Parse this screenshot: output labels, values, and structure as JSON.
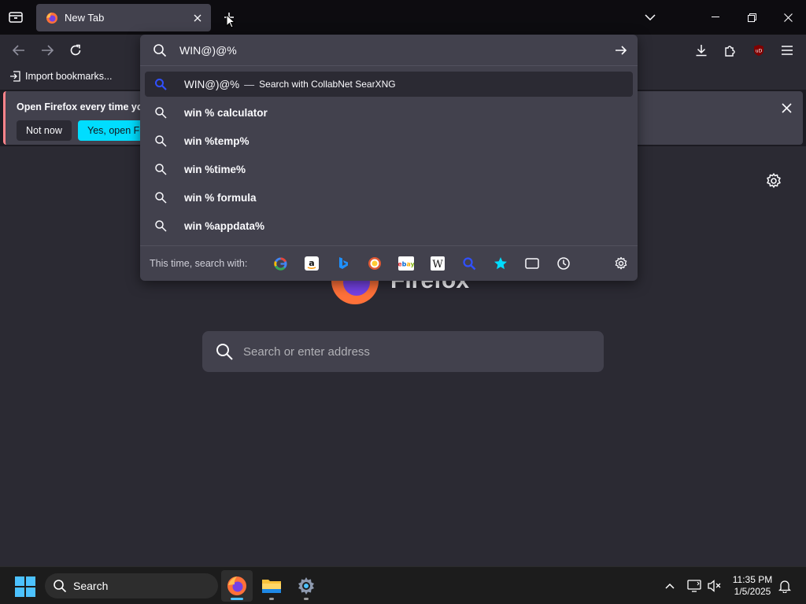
{
  "tab": {
    "title": "New Tab"
  },
  "bookmarks": {
    "import_label": "Import bookmarks..."
  },
  "notification": {
    "message": "Open Firefox every time you",
    "not_now": "Not now",
    "yes_label": "Yes, open Firefox"
  },
  "content": {
    "logo_word": "Firefox",
    "search_placeholder": "Search or enter address"
  },
  "urlbar": {
    "input_value": "WIN@)@%",
    "selected": {
      "text": "WIN@)@%",
      "dash": "—",
      "engine_label": "Search with CollabNet SearXNG"
    },
    "suggestions": [
      "win % calculator",
      "win %temp%",
      "win %time%",
      "win % formula",
      "win %appdata%"
    ],
    "oneoff_label": "This time, search with:",
    "oneoff_engines": [
      "google-icon",
      "amazon-icon",
      "bing-icon",
      "duckduckgo-icon",
      "ebay-icon",
      "wikipedia-icon",
      "searxng-icon",
      "bookmarks-icon",
      "tabs-icon",
      "history-icon"
    ]
  },
  "taskbar": {
    "search_label": "Search",
    "time": "11:35 PM",
    "date": "1/5/2025"
  },
  "colors": {
    "accent": "#00ddff",
    "notification_border": "#ff848b",
    "toolbar": "#2b2a33",
    "popup": "#42414d"
  }
}
